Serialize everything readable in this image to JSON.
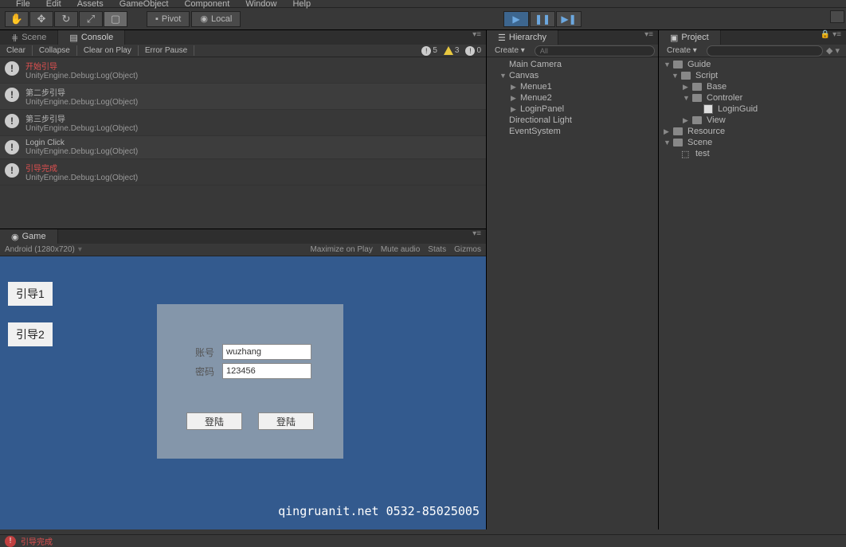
{
  "menubar": [
    "File",
    "Edit",
    "Assets",
    "GameObject",
    "Component",
    "Window",
    "Help"
  ],
  "toolbar": {
    "pivot": "Pivot",
    "local": "Local"
  },
  "sceneTab": "Scene",
  "consoleTab": "Console",
  "consoleToolbar": {
    "clear": "Clear",
    "collapse": "Collapse",
    "clearOnPlay": "Clear on Play",
    "errorPause": "Error Pause",
    "infoCount": "5",
    "warnCount": "3",
    "errCount": "0"
  },
  "logs": [
    {
      "msg": "开始引导",
      "src": "UnityEngine.Debug:Log(Object)",
      "red": true
    },
    {
      "msg": "第二步引导",
      "src": "UnityEngine.Debug:Log(Object)",
      "red": false
    },
    {
      "msg": "第三步引导",
      "src": "UnityEngine.Debug:Log(Object)",
      "red": false
    },
    {
      "msg": "Login Click",
      "src": "UnityEngine.Debug:Log(Object)",
      "red": false
    },
    {
      "msg": "引导完成",
      "src": "UnityEngine.Debug:Log(Object)",
      "red": true
    }
  ],
  "gameTab": "Game",
  "gameToolbar": {
    "resolution": "Android (1280x720)",
    "maximize": "Maximize on Play",
    "mute": "Mute audio",
    "stats": "Stats",
    "gizmos": "Gizmos"
  },
  "gameView": {
    "guide1": "引导1",
    "guide2": "引导2",
    "usernameLabel": "账号",
    "usernameValue": "wuzhang",
    "passwordLabel": "密码",
    "passwordValue": "123456",
    "loginBtn1": "登陆",
    "loginBtn2": "登陆",
    "watermark": "qingruanit.net 0532-85025005"
  },
  "hierarchyTab": "Hierarchy",
  "hierarchyToolbar": {
    "create": "Create",
    "searchPlaceholder": "All"
  },
  "hierarchy": [
    {
      "name": "Main Camera",
      "indent": 1,
      "arrow": ""
    },
    {
      "name": "Canvas",
      "indent": 1,
      "arrow": "▼"
    },
    {
      "name": "Menue1",
      "indent": 2,
      "arrow": "▶"
    },
    {
      "name": "Menue2",
      "indent": 2,
      "arrow": "▶"
    },
    {
      "name": "LoginPanel",
      "indent": 2,
      "arrow": "▶"
    },
    {
      "name": "Directional Light",
      "indent": 1,
      "arrow": ""
    },
    {
      "name": "EventSystem",
      "indent": 1,
      "arrow": ""
    }
  ],
  "projectTab": "Project",
  "projectToolbar": {
    "create": "Create"
  },
  "project": [
    {
      "name": "Guide",
      "indent": 0,
      "arrow": "▼",
      "icon": "folder"
    },
    {
      "name": "Script",
      "indent": 1,
      "arrow": "▼",
      "icon": "folder"
    },
    {
      "name": "Base",
      "indent": 2,
      "arrow": "▶",
      "icon": "folder"
    },
    {
      "name": "Controler",
      "indent": 2,
      "arrow": "▼",
      "icon": "folder"
    },
    {
      "name": "LoginGuid",
      "indent": 3,
      "arrow": "",
      "icon": "script"
    },
    {
      "name": "View",
      "indent": 2,
      "arrow": "▶",
      "icon": "folder"
    },
    {
      "name": "Resource",
      "indent": 0,
      "arrow": "▶",
      "icon": "folder"
    },
    {
      "name": "Scene",
      "indent": 0,
      "arrow": "▼",
      "icon": "folder"
    },
    {
      "name": "test",
      "indent": 1,
      "arrow": "",
      "icon": "unity"
    }
  ],
  "footer": {
    "msg": "引导完成"
  }
}
